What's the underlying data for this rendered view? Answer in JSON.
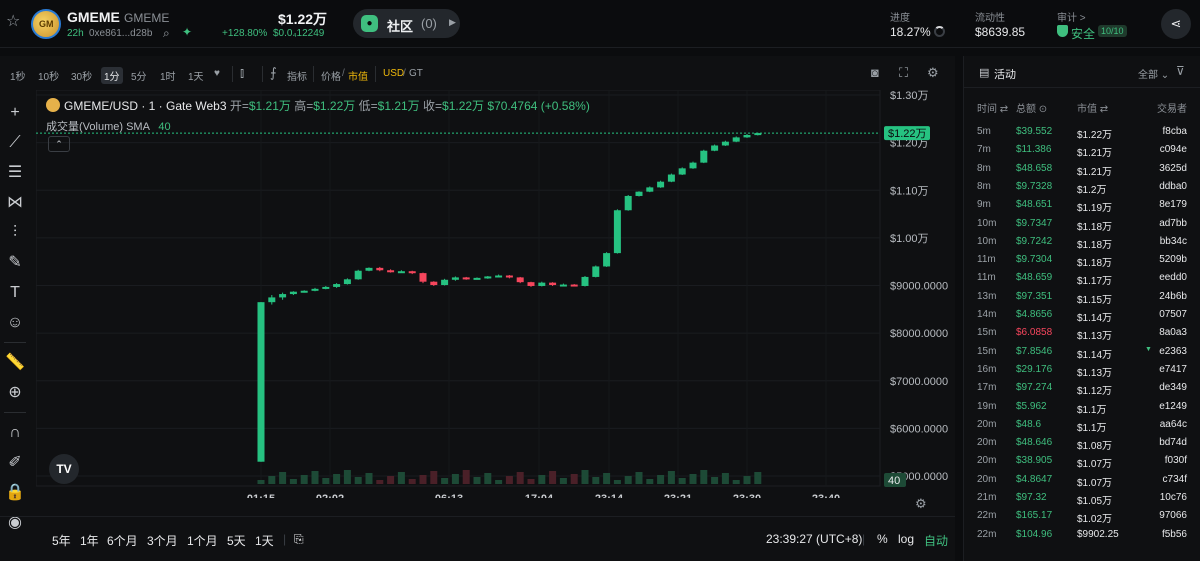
{
  "header": {
    "token_name": "GMEME",
    "token_symbol": "GMEME",
    "age": "22h",
    "address": "0xe861...d28b",
    "price": "$1.22万",
    "change_pct": "+128.80%",
    "change_abs": "$0.0₄12249",
    "community_label": "社区",
    "community_count": "(0)",
    "progress_label": "进度",
    "progress_value": "18.27%",
    "liquidity_label": "流动性",
    "liquidity_value": "$8639.85",
    "audit_label": "审计 >",
    "audit_value": "安全",
    "audit_score": "10/10"
  },
  "toolbar": {
    "intervals": [
      "1秒",
      "10秒",
      "30秒",
      "1分",
      "5分",
      "1时",
      "1天"
    ],
    "active_interval": "1分",
    "indicators": "指标",
    "price": "价格",
    "mcap": "市值",
    "usd": "USD",
    "gt": "GT"
  },
  "legend": {
    "pair": "GMEME/USD · 1 · Gate Web3",
    "o_lbl": "开=",
    "o": "$1.21万",
    "h_lbl": "高=",
    "h": "$1.22万",
    "l_lbl": "低=",
    "l": "$1.21万",
    "c_lbl": "收=",
    "c": "$1.22万",
    "change": "$70.4764 (+0.58%)",
    "volume_label": "成交量(Volume)",
    "sma_label": "SMA",
    "sma_value": "40"
  },
  "bottom": {
    "ranges": [
      "5年",
      "1年",
      "6个月",
      "3个月",
      "1个月",
      "5天",
      "1天"
    ],
    "clock": "23:39:27 (UTC+8)",
    "pct": "%",
    "log": "log",
    "auto": "自动"
  },
  "chart_data": {
    "type": "candlestick",
    "y_ticks": [
      "$1.30万",
      "$1.20万",
      "$1.10万",
      "$1.00万",
      "$9000.0000",
      "$8000.0000",
      "$7000.0000",
      "$6000.0000",
      "$5000.0000"
    ],
    "y_values": [
      13000,
      12000,
      11000,
      10000,
      9000,
      8000,
      7000,
      6000,
      5000
    ],
    "x_ticks": [
      "01:15",
      "02:02",
      "06:13",
      "17:04",
      "23:14",
      "23:21",
      "23:30",
      "23:40"
    ],
    "last_price_label": "$1.22万",
    "volume_badge": "40",
    "candles": [
      [
        5300,
        8650,
        5300,
        8650
      ],
      [
        8650,
        8800,
        8600,
        8750
      ],
      [
        8750,
        8850,
        8700,
        8820
      ],
      [
        8820,
        8880,
        8800,
        8870
      ],
      [
        8870,
        8900,
        8850,
        8890
      ],
      [
        8890,
        8950,
        8880,
        8930
      ],
      [
        8930,
        8990,
        8920,
        8970
      ],
      [
        8970,
        9050,
        8950,
        9030
      ],
      [
        9030,
        9150,
        9020,
        9130
      ],
      [
        9130,
        9330,
        9120,
        9310
      ],
      [
        9310,
        9380,
        9300,
        9370
      ],
      [
        9370,
        9390,
        9300,
        9320
      ],
      [
        9320,
        9340,
        9270,
        9290
      ],
      [
        9290,
        9320,
        9270,
        9300
      ],
      [
        9300,
        9310,
        9240,
        9260
      ],
      [
        9260,
        9270,
        9050,
        9080
      ],
      [
        9080,
        9090,
        8990,
        9010
      ],
      [
        9010,
        9140,
        9000,
        9120
      ],
      [
        9120,
        9190,
        9100,
        9170
      ],
      [
        9170,
        9180,
        9120,
        9140
      ],
      [
        9140,
        9170,
        9130,
        9160
      ],
      [
        9160,
        9200,
        9140,
        9190
      ],
      [
        9190,
        9230,
        9180,
        9210
      ],
      [
        9210,
        9220,
        9150,
        9170
      ],
      [
        9170,
        9180,
        9050,
        9070
      ],
      [
        9070,
        9080,
        8970,
        8990
      ],
      [
        8990,
        9080,
        8980,
        9060
      ],
      [
        9060,
        9070,
        8990,
        9010
      ],
      [
        9010,
        9040,
        8990,
        9020
      ],
      [
        9020,
        9030,
        8980,
        8990
      ],
      [
        8990,
        9200,
        8980,
        9180
      ],
      [
        9180,
        9420,
        9170,
        9400
      ],
      [
        9400,
        9700,
        9390,
        9680
      ],
      [
        9680,
        10600,
        9670,
        10580
      ],
      [
        10580,
        10900,
        10570,
        10880
      ],
      [
        10880,
        10980,
        10870,
        10970
      ],
      [
        10970,
        11080,
        10960,
        11060
      ],
      [
        11060,
        11200,
        11050,
        11180
      ],
      [
        11180,
        11350,
        11170,
        11330
      ],
      [
        11330,
        11480,
        11320,
        11460
      ],
      [
        11460,
        11600,
        11450,
        11580
      ],
      [
        11580,
        11850,
        11570,
        11830
      ],
      [
        11830,
        11960,
        11820,
        11940
      ],
      [
        11940,
        12040,
        11930,
        12020
      ],
      [
        12020,
        12130,
        12010,
        12110
      ],
      [
        12110,
        12180,
        12100,
        12160
      ],
      [
        12160,
        12210,
        12150,
        12200
      ]
    ]
  },
  "activity": {
    "title": "活动",
    "filter": "全部",
    "cols": [
      "时间",
      "总额",
      "市值",
      "交易者"
    ],
    "rows": [
      [
        "5m",
        "$39.552",
        "$1.22万",
        "f8cba",
        "g"
      ],
      [
        "7m",
        "$11.386",
        "$1.21万",
        "c094e",
        "g"
      ],
      [
        "8m",
        "$48.658",
        "$1.21万",
        "3625d",
        "g"
      ],
      [
        "8m",
        "$9.7328",
        "$1.2万",
        "ddba0",
        "g"
      ],
      [
        "9m",
        "$48.651",
        "$1.19万",
        "8e179",
        "g"
      ],
      [
        "10m",
        "$9.7347",
        "$1.18万",
        "ad7bb",
        "g"
      ],
      [
        "10m",
        "$9.7242",
        "$1.18万",
        "bb34c",
        "g"
      ],
      [
        "11m",
        "$9.7304",
        "$1.18万",
        "5209b",
        "g"
      ],
      [
        "11m",
        "$48.659",
        "$1.17万",
        "eedd0",
        "g"
      ],
      [
        "13m",
        "$97.351",
        "$1.15万",
        "24b6b",
        "g"
      ],
      [
        "14m",
        "$4.8656",
        "$1.14万",
        "07507",
        "g"
      ],
      [
        "15m",
        "$6.0858",
        "$1.13万",
        "8a0a3",
        "r"
      ],
      [
        "15m",
        "$7.8546",
        "$1.14万",
        "e2363",
        "g"
      ],
      [
        "16m",
        "$29.176",
        "$1.13万",
        "e7417",
        "g"
      ],
      [
        "17m",
        "$97.274",
        "$1.12万",
        "de349",
        "g"
      ],
      [
        "19m",
        "$5.962",
        "$1.1万",
        "e1249",
        "g"
      ],
      [
        "20m",
        "$48.6",
        "$1.1万",
        "aa64c",
        "g"
      ],
      [
        "20m",
        "$48.646",
        "$1.08万",
        "bd74d",
        "g"
      ],
      [
        "20m",
        "$38.905",
        "$1.07万",
        "f030f",
        "g"
      ],
      [
        "20m",
        "$4.8647",
        "$1.07万",
        "c734f",
        "g"
      ],
      [
        "21m",
        "$97.32",
        "$1.05万",
        "10c76",
        "g"
      ],
      [
        "22m",
        "$165.17",
        "$1.02万",
        "97066",
        "g"
      ],
      [
        "22m",
        "$104.96",
        "$9902.25",
        "f5b56",
        "g"
      ]
    ]
  },
  "colors": {
    "up": "#26c281",
    "down": "#f6465d",
    "accent": "#3fbf7f"
  }
}
